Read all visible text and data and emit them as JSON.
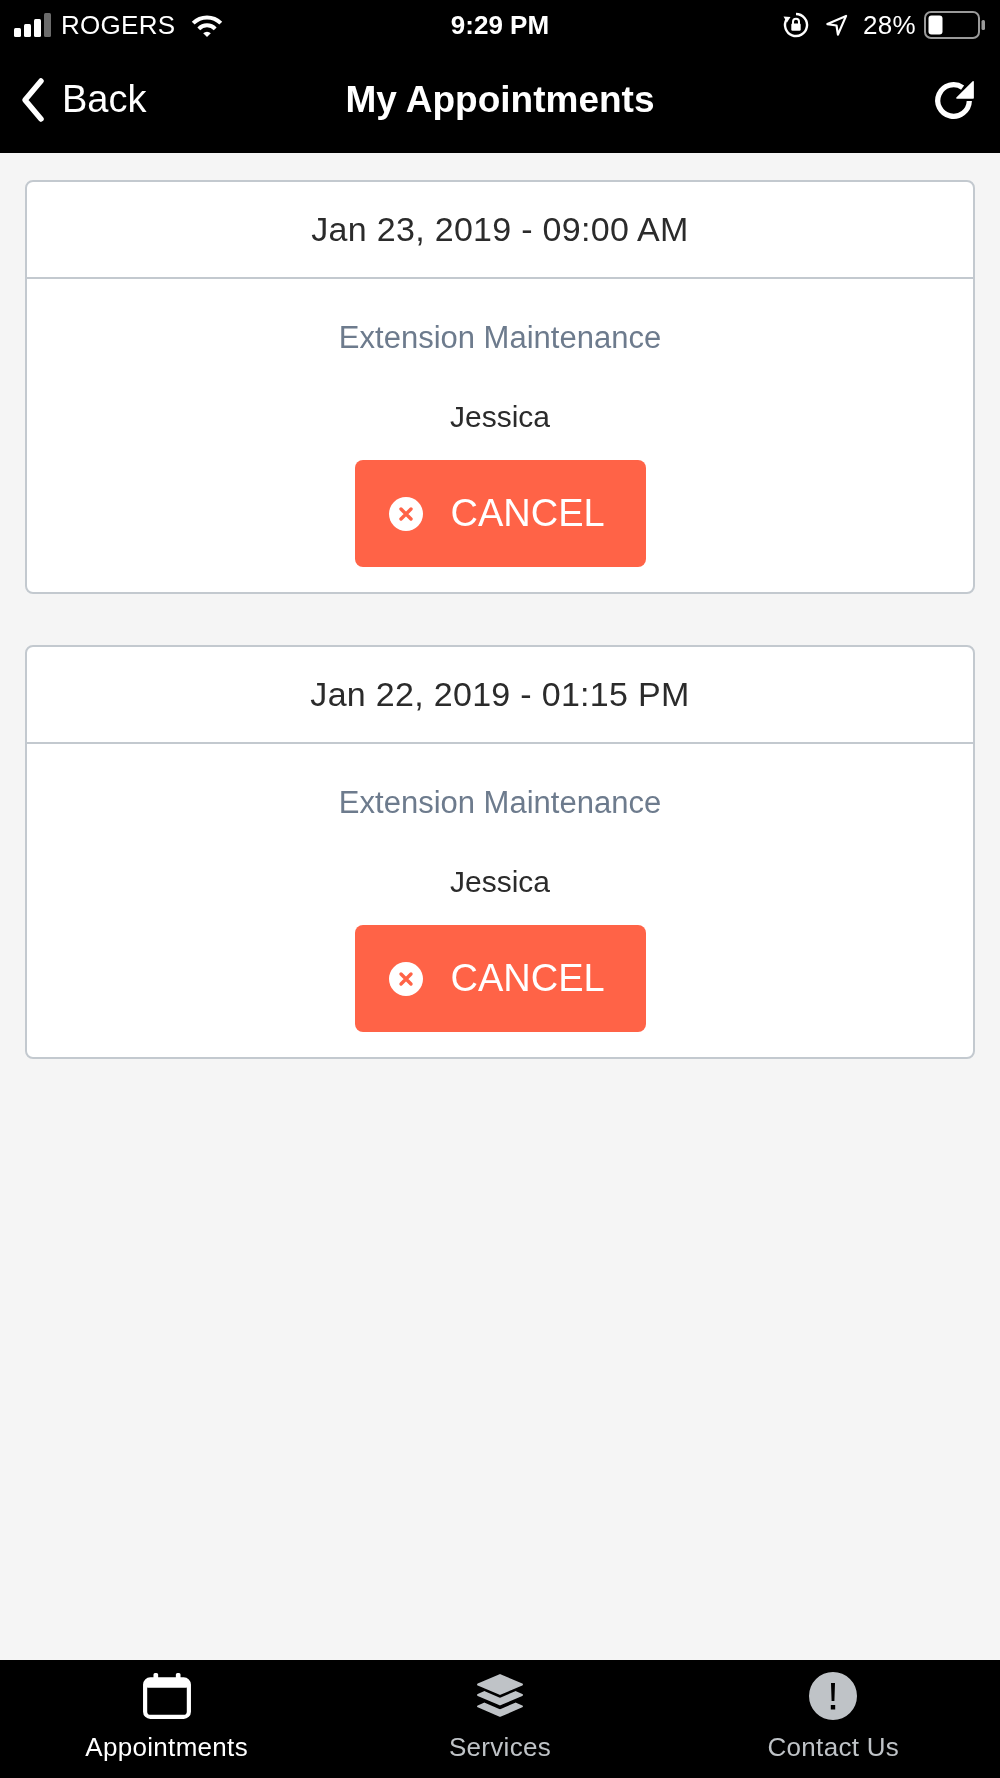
{
  "status_bar": {
    "carrier": "ROGERS",
    "time": "9:29 PM",
    "battery": "28%"
  },
  "nav_bar": {
    "back": "Back",
    "title": "My Appointments"
  },
  "appointments": [
    {
      "datetime": "Jan 23, 2019 - 09:00 AM",
      "service": "Extension Maintenance",
      "staff": "Jessica",
      "action": "CANCEL"
    },
    {
      "datetime": "Jan 22, 2019 - 01:15 PM",
      "service": "Extension Maintenance",
      "staff": "Jessica",
      "action": "CANCEL"
    }
  ],
  "tab_bar": {
    "tabs": [
      {
        "kind": "calendar",
        "label": "Appointments",
        "selected": true
      },
      {
        "kind": "layers",
        "label": "Services",
        "selected": false
      },
      {
        "kind": "alert",
        "label": "Contact Us",
        "selected": false
      }
    ]
  }
}
